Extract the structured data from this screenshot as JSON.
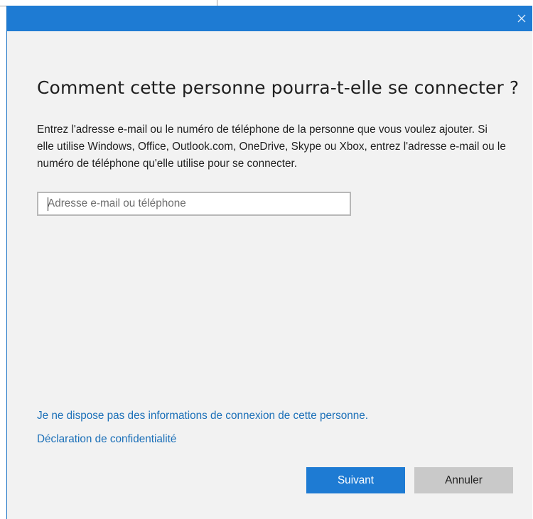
{
  "dialog": {
    "close_icon": "close-icon",
    "heading": "Comment cette personne pourra-t-elle se connecter ?",
    "description": "Entrez l'adresse e-mail ou le numéro de téléphone de la personne que vous voulez ajouter. Si elle utilise Windows, Office, Outlook.com, OneDrive, Skype ou Xbox, entrez l'adresse e-mail ou le numéro de téléphone qu'elle utilise pour se connecter.",
    "email_field": {
      "value": "",
      "placeholder": "Adresse e-mail ou téléphone"
    },
    "links": {
      "no_info": "Je ne dispose pas des informations de connexion de cette personne.",
      "privacy": "Déclaration de confidentialité"
    },
    "buttons": {
      "next": "Suivant",
      "cancel": "Annuler"
    }
  },
  "colors": {
    "accent": "#1e7bd3",
    "link": "#1a6fb8",
    "background": "#f2f2f2",
    "secondary_button": "#c9c9c9"
  }
}
